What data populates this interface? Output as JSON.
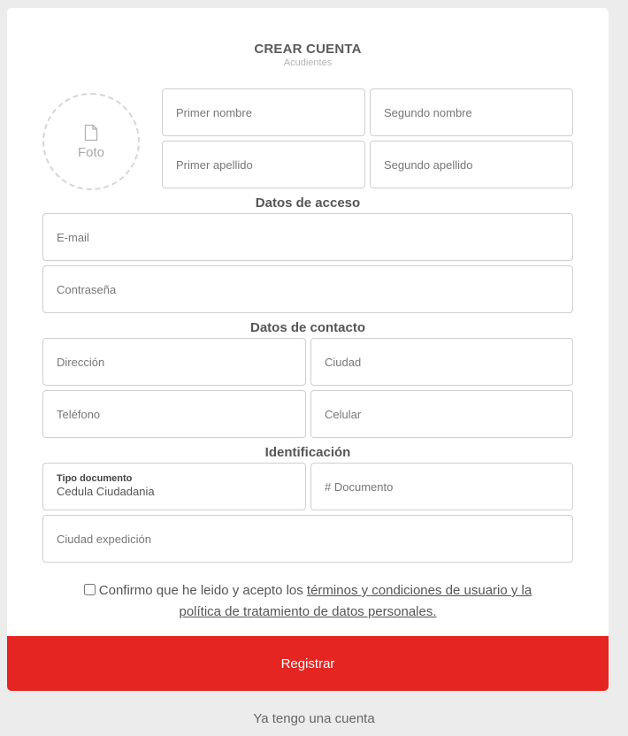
{
  "header": {
    "title": "CREAR CUENTA",
    "subtitle": "Acudientes"
  },
  "photo": {
    "label": "Foto",
    "icon": "file-icon"
  },
  "name_fields": {
    "first_name": "Primer nombre",
    "second_name": "Segundo nombre",
    "first_surname": "Primer apellido",
    "second_surname": "Segundo apellido"
  },
  "access": {
    "heading": "Datos de acceso",
    "email": "E-mail",
    "password": "Contraseña"
  },
  "contact": {
    "heading": "Datos de contacto",
    "address": "Dirección",
    "city": "Ciudad",
    "phone": "Teléfono",
    "cellphone": "Celular"
  },
  "identification": {
    "heading": "Identificación",
    "doc_type_label": "Tipo documento",
    "doc_type_value": "Cedula Ciudadania",
    "doc_number": "# Documento",
    "issue_city": "Ciudad expedición"
  },
  "terms": {
    "prefix": "Confirmo que he leido y acepto los ",
    "link_terms": "términos y condiciones de usuario y la",
    "link_policy": "política de tratamiento de datos personales."
  },
  "actions": {
    "register": "Registrar",
    "have_account": "Ya tengo una cuenta"
  },
  "colors": {
    "accent": "#e52521",
    "background": "#ececec"
  }
}
